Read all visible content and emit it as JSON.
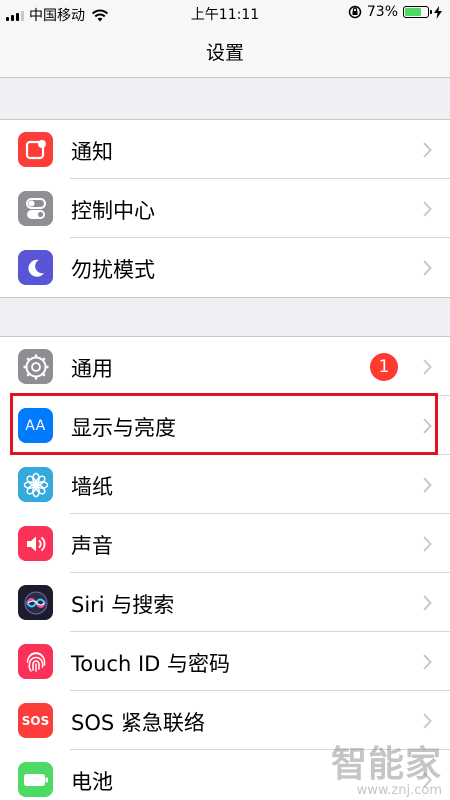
{
  "status_bar": {
    "carrier": "中国移动",
    "time": "上午11:11",
    "battery_percent": "73%",
    "battery_level": 0.73,
    "icons": [
      "signal-icon",
      "wifi-icon",
      "orientation-lock-icon",
      "battery-icon",
      "charging-icon"
    ]
  },
  "nav": {
    "title": "设置"
  },
  "groups": [
    {
      "items": [
        {
          "label": "通知",
          "icon": "notifications-icon",
          "color": "#fc3d39"
        },
        {
          "label": "控制中心",
          "icon": "control-center-icon",
          "color": "#8e8e93"
        },
        {
          "label": "勿扰模式",
          "icon": "moon-icon",
          "color": "#5856d6"
        }
      ]
    },
    {
      "items": [
        {
          "label": "通用",
          "icon": "gear-icon",
          "color": "#8e8e93",
          "badge": "1"
        },
        {
          "label": "显示与亮度",
          "icon": "display-brightness-icon",
          "color": "#007aff",
          "icon_text": "AA"
        },
        {
          "label": "墙纸",
          "icon": "wallpaper-flower-icon",
          "color": "#34aadc"
        },
        {
          "label": "声音",
          "icon": "speaker-icon",
          "color": "#fc3158"
        },
        {
          "label": "Siri 与搜索",
          "icon": "siri-icon",
          "color": "#1c1c2e"
        },
        {
          "label": "Touch ID 与密码",
          "icon": "fingerprint-icon",
          "color": "#fc3158"
        },
        {
          "label": "SOS 紧急联络",
          "icon": "sos-icon",
          "color": "#fc3d39",
          "icon_text": "SOS"
        },
        {
          "label": "电池",
          "icon": "battery-setting-icon",
          "color": "#4cd964"
        }
      ]
    }
  ],
  "highlight_color": "#e0141e",
  "watermark": {
    "text": "智能家",
    "url": "www.znj.com"
  }
}
